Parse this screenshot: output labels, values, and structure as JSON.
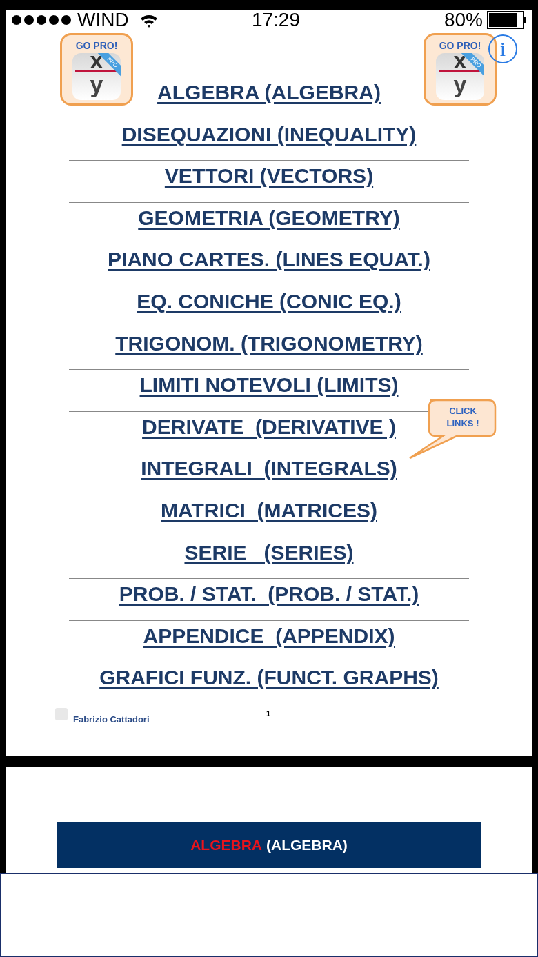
{
  "status_bar": {
    "carrier": "WIND",
    "time": "17:29",
    "battery": "80%"
  },
  "badges": [
    {
      "kind": "plain",
      "label": "GO PRO!",
      "numerator": "x",
      "denominator": "y",
      "ribbon": "PRO"
    },
    {
      "kind": "info",
      "label": "GO PRO!",
      "numerator": "x",
      "denominator": "y",
      "ribbon": "PRO",
      "info": "i"
    }
  ],
  "links": [
    "ALGEBRA (ALGEBRA)",
    "DISEQUAZIONI (INEQUALITY)",
    "VETTORI (VECTORS)",
    "GEOMETRIA (GEOMETRY)",
    "PIANO CARTES. (LINES EQUAT.)",
    "EQ. CONICHE (CONIC EQ.)",
    "TRIGONOM. (TRIGONOMETRY)",
    "LIMITI NOTEVOLI (LIMITS)",
    "DERIVATE  (DERIVATIVE )",
    "INTEGRALI  (INTEGRALS)",
    "MATRICI  (MATRICES)",
    "SERIE   (SERIES)",
    "PROB. / STAT.  (PROB. / STAT.)",
    "APPENDICE  (APPENDIX)",
    "GRAFICI FUNZ. (FUNCT. GRAPHS)"
  ],
  "callout": "CLICK LINKS !",
  "footer": {
    "author": "Fabrizio Cattadori",
    "page_number": "1"
  },
  "banner": {
    "highlight": "ALGEBRA",
    "rest": "(ALGEBRA)"
  }
}
